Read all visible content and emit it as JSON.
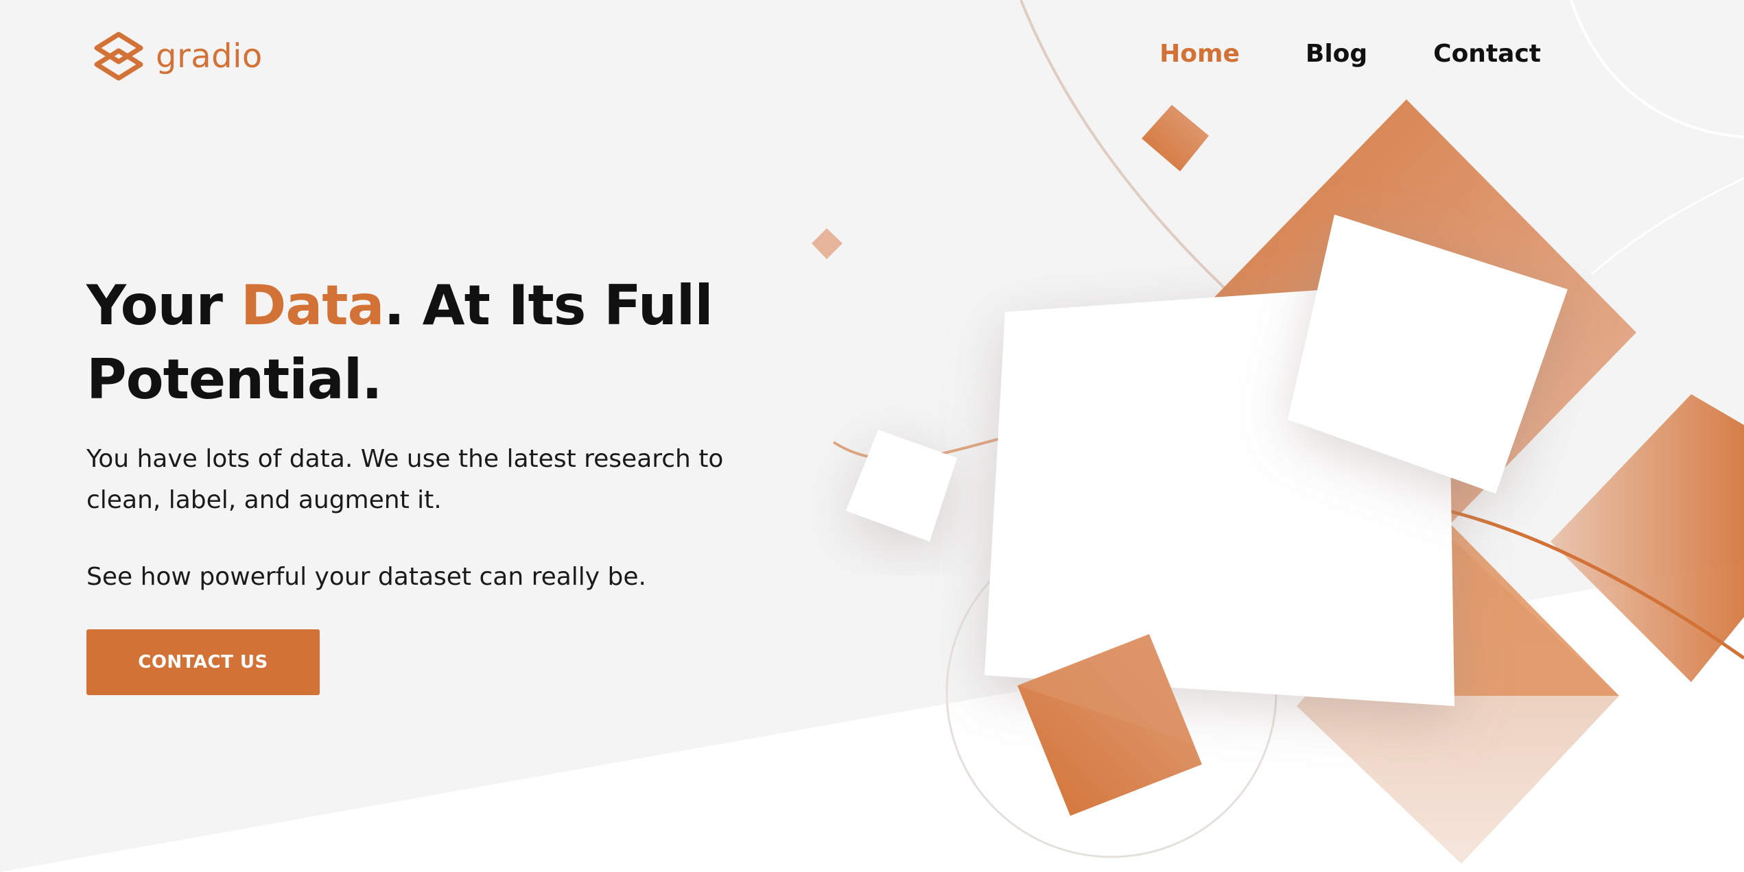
{
  "brand": {
    "name": "gradio",
    "color": "#d37236",
    "logo_icon": "gradio-logo-icon"
  },
  "nav": {
    "items": [
      {
        "label": "Home",
        "active": true
      },
      {
        "label": "Blog",
        "active": false
      },
      {
        "label": "Contact",
        "active": false
      }
    ]
  },
  "hero": {
    "title_part1": "Your ",
    "title_accent": "Data",
    "title_part2": ". At Its Full Potential.",
    "paragraph1": "You have lots of data. We use the latest research to clean, label, and augment it.",
    "paragraph2": "See how powerful your dataset can really be.",
    "cta_label": "CONTACT US"
  },
  "colors": {
    "accent": "#d37236",
    "background": "#f4f4f4",
    "text": "#111111"
  }
}
